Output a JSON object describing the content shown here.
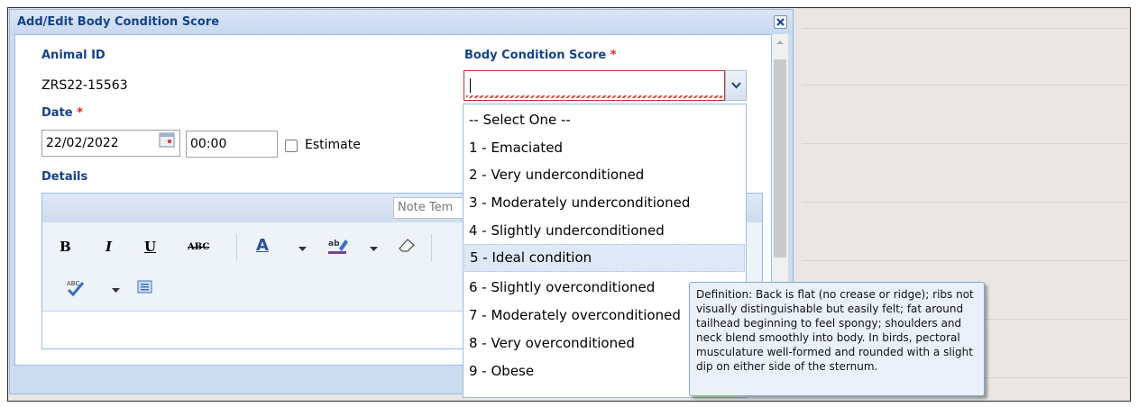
{
  "dialog": {
    "title": "Add/Edit Body Condition Score",
    "close_icon": "close-icon"
  },
  "form": {
    "animal_id_label": "Animal ID",
    "animal_id_value": "ZRS22-15563",
    "date_label": "Date",
    "required_marker": "*",
    "date_value": "22/02/2022",
    "time_value": "00:00",
    "estimate_label": "Estimate",
    "details_label": "Details",
    "bcs_label": "Body Condition Score",
    "bcs_value": ""
  },
  "editor": {
    "note_template_text": "Note Tem",
    "tools": {
      "bold": "B",
      "italic": "I",
      "underline": "U",
      "strike": "ABC",
      "font_color": "A"
    }
  },
  "dropdown": {
    "options": [
      "-- Select One --",
      "1 - Emaciated",
      "2 - Very underconditioned",
      "3 - Moderately underconditioned",
      "4 - Slightly underconditioned",
      "5 - Ideal condition",
      "6 - Slightly overconditioned",
      "7 - Moderately overconditioned",
      "8 - Very overconditioned",
      "9 - Obese"
    ],
    "highlighted_option": "5 - Ideal condition"
  },
  "tooltip": {
    "text": "Definition: Back is flat (no crease or ridge); ribs not visually distinguishable but easily felt; fat around tailhead beginning to feel spongy; shoulders and neck blend smoothly into body. In birds, pectoral musculature well-formed and rounded with a slight dip on either side of the sternum."
  },
  "colors": {
    "header_text": "#15428b",
    "required": "#e02020",
    "invalid_border": "#c0392b",
    "highlight": "#dfe8f6"
  }
}
